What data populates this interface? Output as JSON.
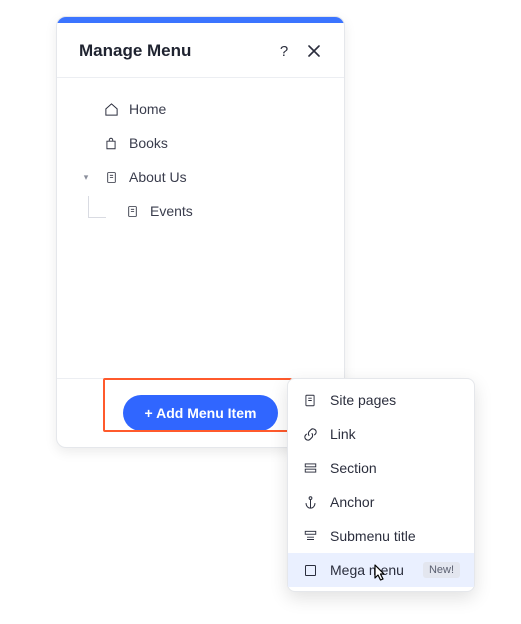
{
  "panel": {
    "title": "Manage Menu",
    "help_tooltip": "?",
    "close_label": "Close"
  },
  "tree": {
    "home": {
      "label": "Home"
    },
    "books": {
      "label": "Books"
    },
    "about": {
      "label": "About Us"
    },
    "events": {
      "label": "Events"
    }
  },
  "footer": {
    "add_label": "+ Add Menu Item"
  },
  "popup": {
    "site_pages": "Site pages",
    "link": "Link",
    "section": "Section",
    "anchor": "Anchor",
    "submenu": "Submenu title",
    "mega": "Mega menu",
    "new_badge": "New!"
  }
}
